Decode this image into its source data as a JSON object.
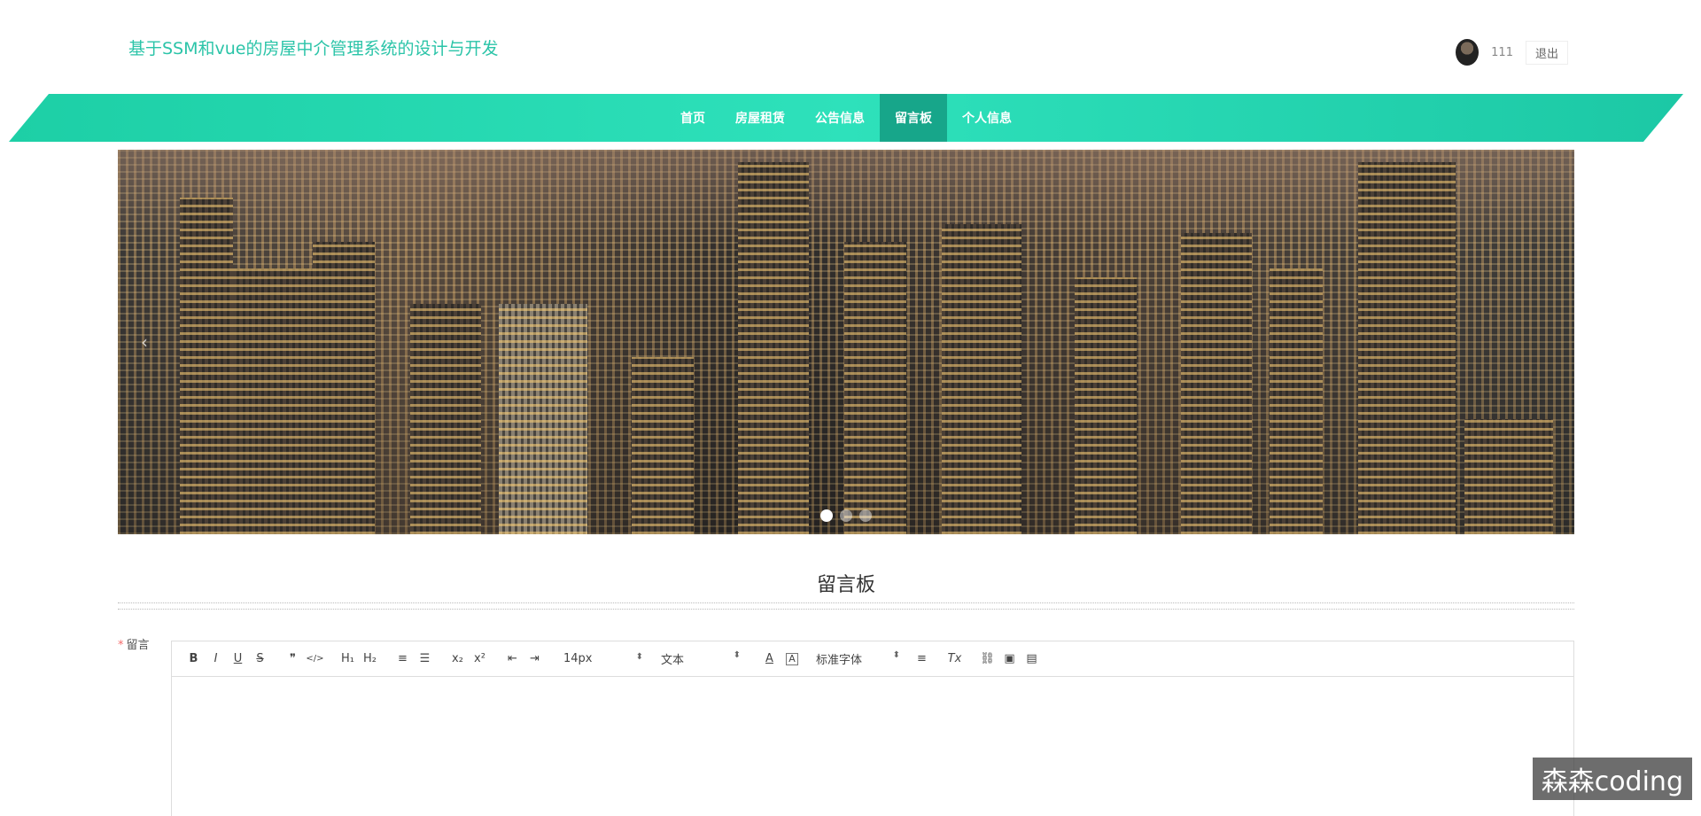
{
  "header": {
    "site_title": "基于SSM和vue的房屋中介管理系统的设计与开发",
    "username": "111",
    "logout_label": "退出"
  },
  "nav": {
    "items": [
      {
        "label": "首页"
      },
      {
        "label": "房屋租赁"
      },
      {
        "label": "公告信息"
      },
      {
        "label": "留言板"
      },
      {
        "label": "个人信息"
      }
    ],
    "active_index": 3
  },
  "banner": {
    "prev_arrow": "‹",
    "slide_count": 3,
    "active_slide": 1
  },
  "section": {
    "title": "留言板"
  },
  "form": {
    "required_mark": "*",
    "label": "留言",
    "toolbar": {
      "bold": "B",
      "italic": "I",
      "underline": "U",
      "strike": "S",
      "blockquote": "❞",
      "code": "</>",
      "h1": "H₁",
      "h2": "H₂",
      "ordered_list": "≡",
      "bullet_list": "☰",
      "subscript": "x₂",
      "superscript": "x²",
      "outdent": "⇤",
      "indent": "⇥",
      "size_value": "14px",
      "header_value": "文本",
      "font_value": "标准字体",
      "color": "A",
      "background": "A",
      "align": "≡",
      "clean": "Tx",
      "link": "⛓",
      "image": "▣",
      "video": "▤"
    }
  },
  "watermark": "森森coding",
  "colors": {
    "accent": "#2bc4a8",
    "nav_active": "#17a68a",
    "required": "#f56c6c"
  }
}
